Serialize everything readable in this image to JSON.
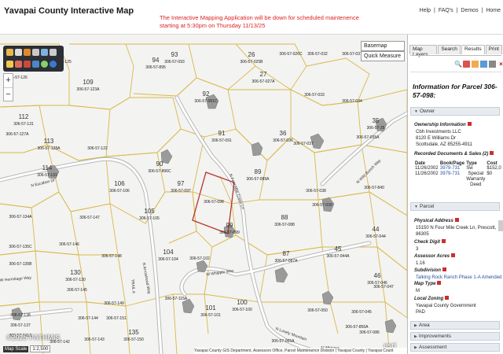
{
  "header": {
    "title": "Yavapai County Interactive Map",
    "notice": "The Interactive Mapping Application will be down for scheduled maintenence starting at 5:30pm on Thursday 11/13/25",
    "links": [
      "Help",
      "|",
      "FAQ's",
      "|",
      "Demos",
      "|",
      "Home"
    ]
  },
  "map": {
    "basemap_label": "Basemap",
    "quick_measure_label": "Quick Measure",
    "zoom_in": "+",
    "zoom_out": "−",
    "scale_label": "Map Scale",
    "scale_value": "1:2,500",
    "watermark": "©2025 PATHMIS",
    "esri": "esri",
    "attribution": "Yavapai County GIS Department, Assessors Office, Parcel Maintenence Division | Yavapai County | Yavapai Count",
    "parcels": [
      {
        "id": "306-57-125",
        "n": ""
      },
      {
        "id": "306-57-126",
        "n": ""
      },
      {
        "id": "306-57-123A",
        "n": "109"
      },
      {
        "id": "306-57-895",
        "n": "94"
      },
      {
        "id": "306-57-093",
        "n": "93"
      },
      {
        "id": "306-57-025B",
        "n": "26"
      },
      {
        "id": "306-57-026C",
        "n": ""
      },
      {
        "id": "306-57-032",
        "n": ""
      },
      {
        "id": "306-57-037",
        "n": ""
      },
      {
        "id": "306-57-027A",
        "n": "27"
      },
      {
        "id": "306-57-091C",
        "n": "92"
      },
      {
        "id": "306-57-033",
        "n": ""
      },
      {
        "id": "306-57-034",
        "n": ""
      },
      {
        "id": "306-57-131",
        "n": "112"
      },
      {
        "id": "306-57-127A",
        "n": ""
      },
      {
        "id": "306-57-35",
        "n": "35"
      },
      {
        "id": "306-57-035A",
        "n": ""
      },
      {
        "id": "306-57-037",
        "n": ""
      },
      {
        "id": "306-57-128A",
        "n": "113"
      },
      {
        "id": "306-57-122",
        "n": ""
      },
      {
        "id": "306-57-896C",
        "n": "90"
      },
      {
        "id": "306-57-091",
        "n": "91"
      },
      {
        "id": "306-57-036",
        "n": "36"
      },
      {
        "id": "306-57-089A",
        "n": "89"
      },
      {
        "id": "306-57-098",
        "n": ""
      },
      {
        "id": "306-57-038",
        "n": ""
      },
      {
        "id": "306-57-039",
        "n": ""
      },
      {
        "id": "306-57-840",
        "n": ""
      },
      {
        "id": "306-57-131",
        "n": "114"
      },
      {
        "id": "306-57-097",
        "n": "97"
      },
      {
        "id": "306-57-106",
        "n": "106"
      },
      {
        "id": "306-57-147",
        "n": ""
      },
      {
        "id": "306-57-105",
        "n": "105"
      },
      {
        "id": "306-57-099",
        "n": "99"
      },
      {
        "id": "306-57-088",
        "n": "88"
      },
      {
        "id": "306-57-134A",
        "n": ""
      },
      {
        "id": "306-57-135C",
        "n": ""
      },
      {
        "id": "306-57-146",
        "n": ""
      },
      {
        "id": "306-57-148",
        "n": ""
      },
      {
        "id": "306-57-104",
        "n": "104"
      },
      {
        "id": "306-57-102",
        "n": ""
      },
      {
        "id": "306-57-087A",
        "n": "87"
      },
      {
        "id": "306-57-044A",
        "n": "45"
      },
      {
        "id": "306-57-135B",
        "n": ""
      },
      {
        "id": "306-57-130",
        "n": "130"
      },
      {
        "id": "306-57-145",
        "n": ""
      },
      {
        "id": "306-57-149",
        "n": ""
      },
      {
        "id": "306-57-115A",
        "n": ""
      },
      {
        "id": "306-57-046",
        "n": "46"
      },
      {
        "id": "306-57-101",
        "n": "101"
      },
      {
        "id": "306-57-100",
        "n": "100"
      },
      {
        "id": "306-57-138",
        "n": ""
      },
      {
        "id": "306-57-144",
        "n": ""
      },
      {
        "id": "306-57-151",
        "n": ""
      },
      {
        "id": "306-57-137",
        "n": ""
      },
      {
        "id": "306-57-143",
        "n": ""
      },
      {
        "id": "306-57-150",
        "n": "135"
      },
      {
        "id": "306-57-141A",
        "n": ""
      },
      {
        "id": "306-57-142",
        "n": ""
      },
      {
        "id": "306-57-065A",
        "n": ""
      },
      {
        "id": "306-57-050",
        "n": ""
      },
      {
        "id": "306-57-856A",
        "n": ""
      },
      {
        "id": "306-57-044",
        "n": "44"
      },
      {
        "id": "306-57-047",
        "n": ""
      },
      {
        "id": "306-57-045",
        "n": ""
      },
      {
        "id": "306-57-086",
        "n": ""
      }
    ],
    "roads": [
      "N Escabon Dr",
      "N Four Mile Creek Ln",
      "N Wild Bunch Way",
      "W Hermitage Way",
      "N Arrowhead Way",
      "W Whipple Way",
      "N Lonely Mountain",
      "TRAIL A",
      "N Whisper"
    ]
  },
  "panel": {
    "tabs": [
      "Map Layers",
      "Search",
      "Results",
      "Print"
    ],
    "active_tab": "Results",
    "info_title": "Information for Parcel 306-57-098:",
    "owner_section": "Owner",
    "ownership_label": "Ownership Information",
    "owner_name": "Cbh Investments LLC",
    "owner_address1": "8120 E Williams Dr",
    "owner_address2": "Scottsdale, AZ 85255-4911",
    "sales_label": "Recorded Documents & Sales (2)",
    "sales_headers": [
      "Date",
      "Book/Page",
      "Type",
      "Cost"
    ],
    "sales_rows": [
      {
        "date": "11/26/2002",
        "book": "3979-731",
        "type": "Sw",
        "cost": "$152,0"
      },
      {
        "date": "11/26/2002",
        "book": "3979-731",
        "type": "Special Warranty Deed",
        "cost": "$0"
      }
    ],
    "parcel_section": "Parcel",
    "physical_address_label": "Physical Address",
    "physical_address": "15150 N Four Mile Creek Ln, Prescott, 86305",
    "check_digit_label": "Check Digit",
    "check_digit": "3",
    "assessor_acres_label": "Assessor Acres",
    "assessor_acres": "1.16",
    "subdivision_label": "Subdivision",
    "subdivision": "Talking Rock Ranch Phase 1-A Amended",
    "map_type_label": "Map Type",
    "map_type": "M",
    "local_zoning_label": "Local Zoning",
    "local_zoning1": "Yavapai County Government",
    "local_zoning2": "PAD",
    "area_section": "Area",
    "improvements_section": "Improvements",
    "assessment_section": "Assessment"
  }
}
